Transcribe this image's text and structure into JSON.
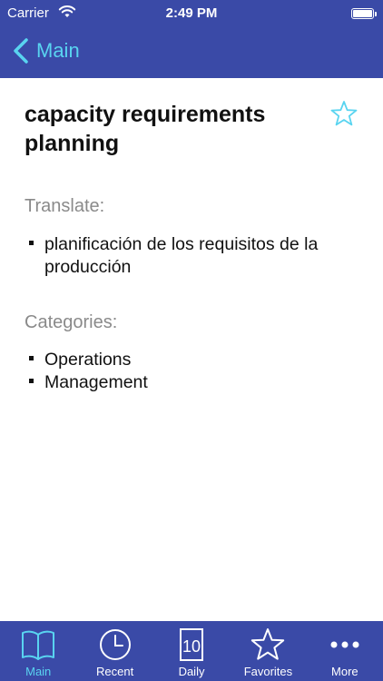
{
  "status_bar": {
    "carrier": "Carrier",
    "time": "2:49 PM"
  },
  "nav": {
    "back_label": "Main"
  },
  "term": {
    "title": "capacity requirements planning"
  },
  "translate": {
    "label": "Translate:",
    "items": [
      "planificación de los requisitos de la producción"
    ]
  },
  "categories": {
    "label": "Categories:",
    "items": [
      "Operations",
      "Management"
    ]
  },
  "tabs": [
    {
      "label": "Main",
      "icon": "book-icon",
      "active": true
    },
    {
      "label": "Recent",
      "icon": "clock-icon",
      "active": false
    },
    {
      "label": "Daily",
      "icon": "calendar-icon",
      "day": "10",
      "active": false
    },
    {
      "label": "Favorites",
      "icon": "star-icon",
      "active": false
    },
    {
      "label": "More",
      "icon": "more-icon",
      "active": false
    }
  ],
  "colors": {
    "bar_background": "#3a4aa7",
    "accent": "#59d4f0"
  }
}
